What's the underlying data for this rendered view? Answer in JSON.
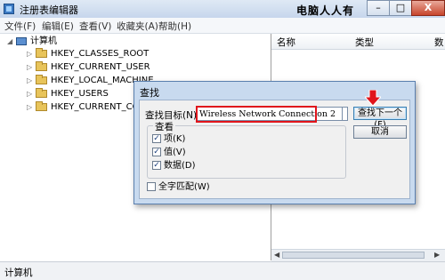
{
  "window": {
    "title": "注册表编辑器",
    "watermark": "电脑人人有",
    "buttons": {
      "minimize": "–",
      "maximize": "□",
      "close": "X"
    }
  },
  "menu": [
    "文件(F)",
    "编辑(E)",
    "查看(V)",
    "收藏夹(A)",
    "帮助(H)"
  ],
  "tree": {
    "root": "计算机",
    "items": [
      "HKEY_CLASSES_ROOT",
      "HKEY_CURRENT_USER",
      "HKEY_LOCAL_MACHINE",
      "HKEY_USERS",
      "HKEY_CURRENT_CONFIG"
    ]
  },
  "list_headers": [
    "名称",
    "类型",
    "数"
  ],
  "status": "计算机",
  "find_dialog": {
    "title": "查找",
    "field_label": "查找目标(N):",
    "field_value": "Wireless Network Connection 2",
    "find_next": "查找下一个(F)",
    "cancel": "取消",
    "look_at_group": "查看",
    "options": [
      {
        "label": "项(K)",
        "checked": true
      },
      {
        "label": "值(V)",
        "checked": true
      },
      {
        "label": "数据(D)",
        "checked": true
      }
    ],
    "match_whole": {
      "label": "全字匹配(W)",
      "checked": false
    },
    "check_mark": "✓"
  }
}
